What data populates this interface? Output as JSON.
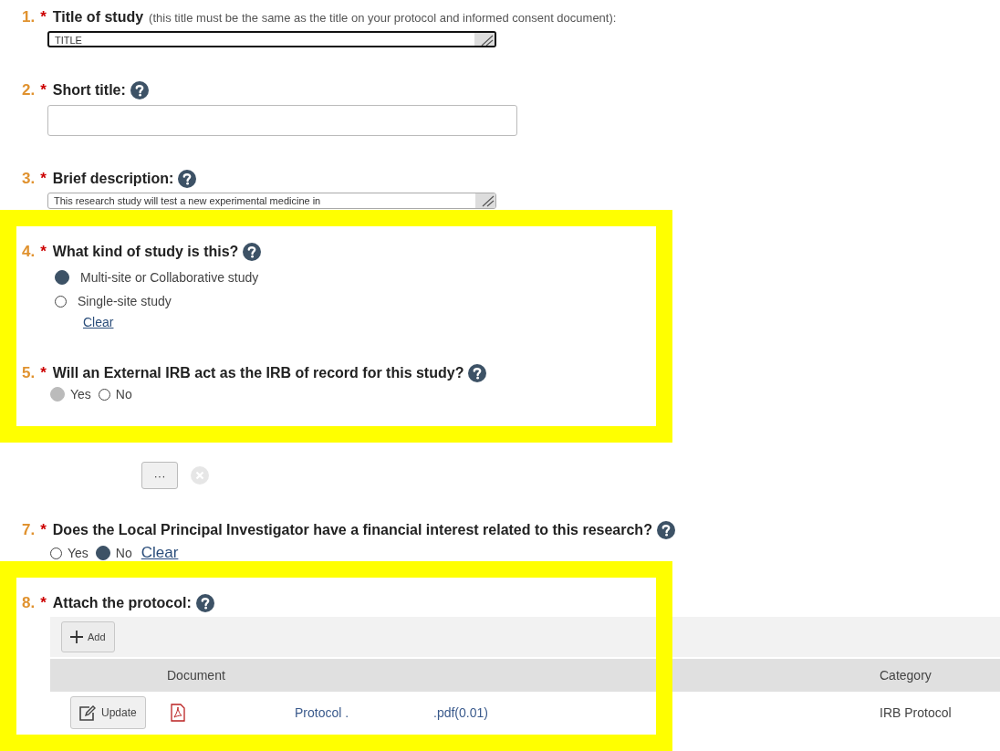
{
  "questions": [
    {
      "number": "1.",
      "required": "*",
      "label": "Title of study",
      "note": "(this title must be the same as the title on your protocol and informed consent document):",
      "kind": "textarea",
      "value": "TITLE",
      "focused": true
    },
    {
      "number": "2.",
      "required": "*",
      "label": "Short title:",
      "help": true,
      "kind": "text"
    },
    {
      "number": "3.",
      "required": "*",
      "label": "Brief description:",
      "help": true,
      "kind": "textarea",
      "value": "This research study will test a new experimental medicine in",
      "focused": false
    },
    {
      "number": "4.",
      "required": "*",
      "label": "What kind of study is this?",
      "help": true,
      "kind": "radio-list",
      "options": [
        {
          "label": "Multi-site or Collaborative study",
          "selected": true,
          "disabled": false
        },
        {
          "label": "Single-site study",
          "selected": false,
          "disabled": false
        }
      ],
      "clear": "Clear"
    },
    {
      "number": "5.",
      "required": "*",
      "label": "Will an External IRB act as the IRB of record for this study?",
      "help": true,
      "kind": "radio-inline",
      "options": [
        {
          "label": "Yes",
          "selected": true,
          "disabled": true
        },
        {
          "label": "No",
          "selected": false,
          "disabled": false
        }
      ]
    },
    {
      "kind": "picker",
      "button": "···"
    },
    {
      "number": "7.",
      "required": "*",
      "label": "Does the Local Principal Investigator have a financial interest related to this research?",
      "help": true,
      "kind": "radio-inline",
      "options": [
        {
          "label": "Yes",
          "selected": false,
          "disabled": false
        },
        {
          "label": "No",
          "selected": true,
          "disabled": false
        }
      ],
      "clear": "Clear"
    },
    {
      "number": "8.",
      "required": "*",
      "label": "Attach the protocol:",
      "help": true,
      "kind": "attachments",
      "add": "Add",
      "columns": [
        "Document",
        "Category"
      ],
      "rows": [
        {
          "action": "Update",
          "name": "Protocol .",
          "size": ".pdf(0.01)",
          "category": "IRB Protocol"
        }
      ]
    }
  ]
}
